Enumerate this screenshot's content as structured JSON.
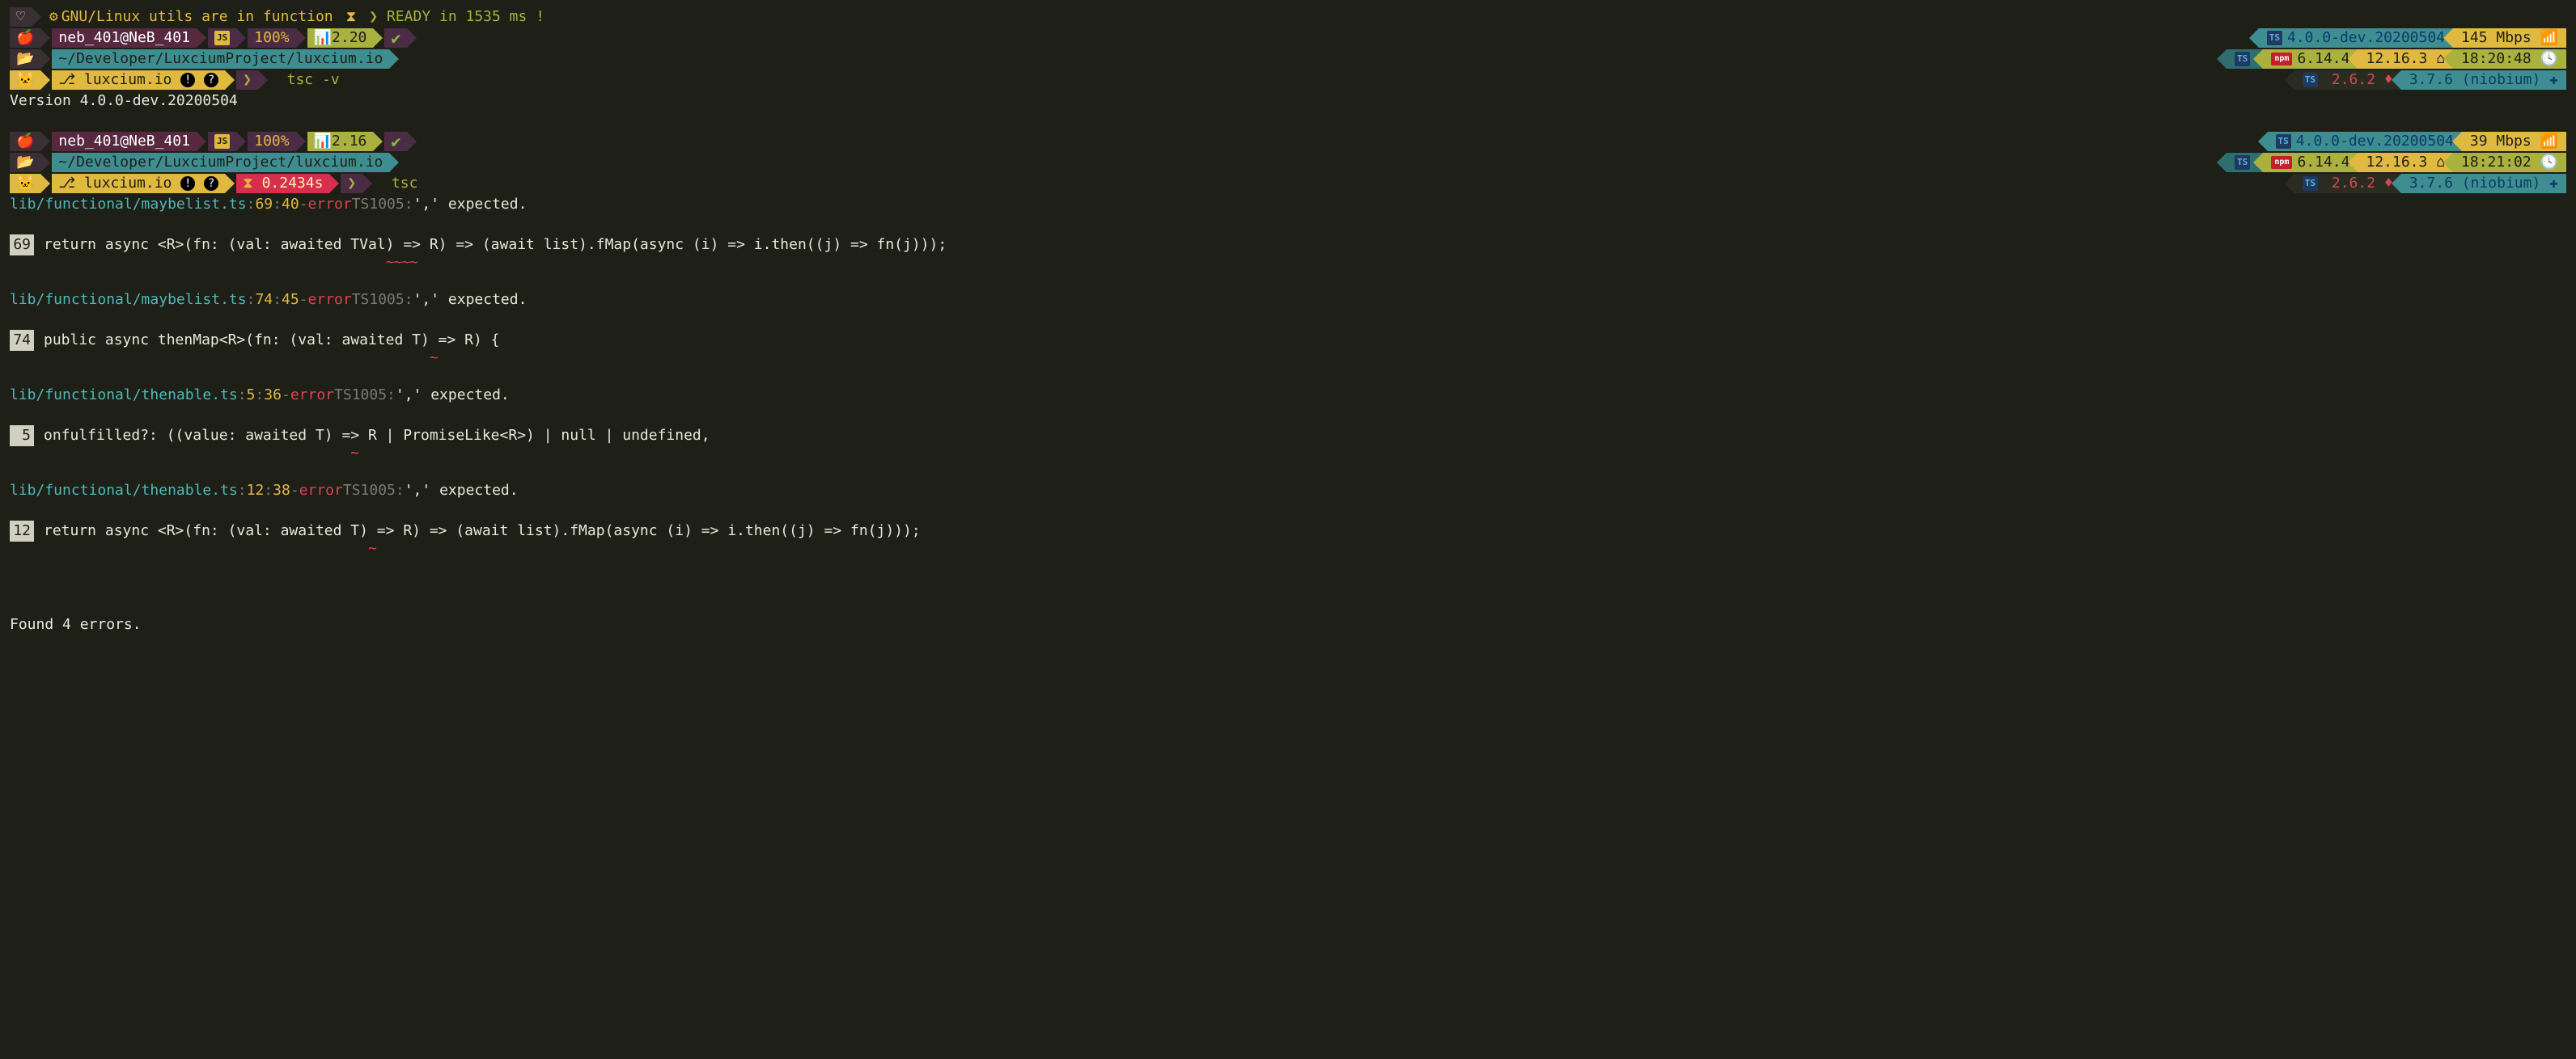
{
  "header": {
    "gnu_text": "GNU/Linux utils are in function",
    "ready_text": "READY in 1535 ms !"
  },
  "prompt1": {
    "user_host": "neb_401@NeB_401",
    "battery": "100%",
    "load": "2.20",
    "path": "~/Developer/LuxciumProject/luxcium.io",
    "repo": "luxcium.io",
    "command": "tsc -v",
    "output": "Version 4.0.0-dev.20200504",
    "right": {
      "ts_version": "4.0.0-dev.20200504",
      "net_speed": "145 Mbps",
      "npm": "6.14.4",
      "node": "12.16.3",
      "time": "18:20:48",
      "ruby": "2.6.2",
      "ruby_label": "3.7.6 (niobium)"
    }
  },
  "prompt2": {
    "user_host": "neb_401@NeB_401",
    "battery": "100%",
    "load": "2.16",
    "path": "~/Developer/LuxciumProject/luxcium.io",
    "repo": "luxcium.io",
    "duration": "0.2434s",
    "command": "tsc",
    "right": {
      "ts_version": "4.0.0-dev.20200504",
      "net_speed": "39 Mbps",
      "npm": "6.14.4",
      "node": "12.16.3",
      "time": "18:21:02",
      "ruby": "2.6.2",
      "ruby_label": "3.7.6 (niobium)"
    }
  },
  "errors": [
    {
      "file": "lib/functional/maybelist.ts",
      "line": "69",
      "col": "40",
      "code": "TS1005",
      "msg": "',' expected.",
      "source": "    return async <R>(fn: (val: awaited TVal) => R) => (await list).fMap(async (i) => i.then((j) => fn(j)));",
      "squiggle_pad": "                                       ",
      "squiggle": "~~~~"
    },
    {
      "file": "lib/functional/maybelist.ts",
      "line": "74",
      "col": "45",
      "code": "TS1005",
      "msg": "',' expected.",
      "source": "  public async thenMap<R>(fn: (val: awaited T) => R) {",
      "squiggle_pad": "                                            ",
      "squiggle": "~"
    },
    {
      "file": "lib/functional/thenable.ts",
      "line": "5",
      "col": "36",
      "code": "TS1005",
      "msg": "',' expected.",
      "source": "    onfulfilled?: ((value: awaited T) => R | PromiseLike<R>) | null | undefined,",
      "squiggle_pad": "                                   ",
      "squiggle": "~"
    },
    {
      "file": "lib/functional/thenable.ts",
      "line": "12",
      "col": "38",
      "code": "TS1005",
      "msg": "',' expected.",
      "source": "  return async <R>(fn: (val: awaited T) => R) => (await list).fMap(async (i) => i.then((j) => fn(j)));",
      "squiggle_pad": "                                     ",
      "squiggle": "~"
    }
  ],
  "summary": "Found 4 errors.",
  "glyphs": {
    "heart": "♡",
    "gear": "⚙",
    "hourglass": "⧗",
    "chevron": "❯",
    "apple": "",
    "folder": "📂",
    "github": "🐱",
    "branch": "⎇",
    "exclaim": "!",
    "question": "?",
    "check": "✔",
    "bars": "▮▯",
    "wifi": "📶",
    "home": "⌂",
    "clock": "🕓",
    "gem": "♦",
    "plus": "✚",
    "js": "JS",
    "ts": "TS",
    "npm": "npm"
  }
}
